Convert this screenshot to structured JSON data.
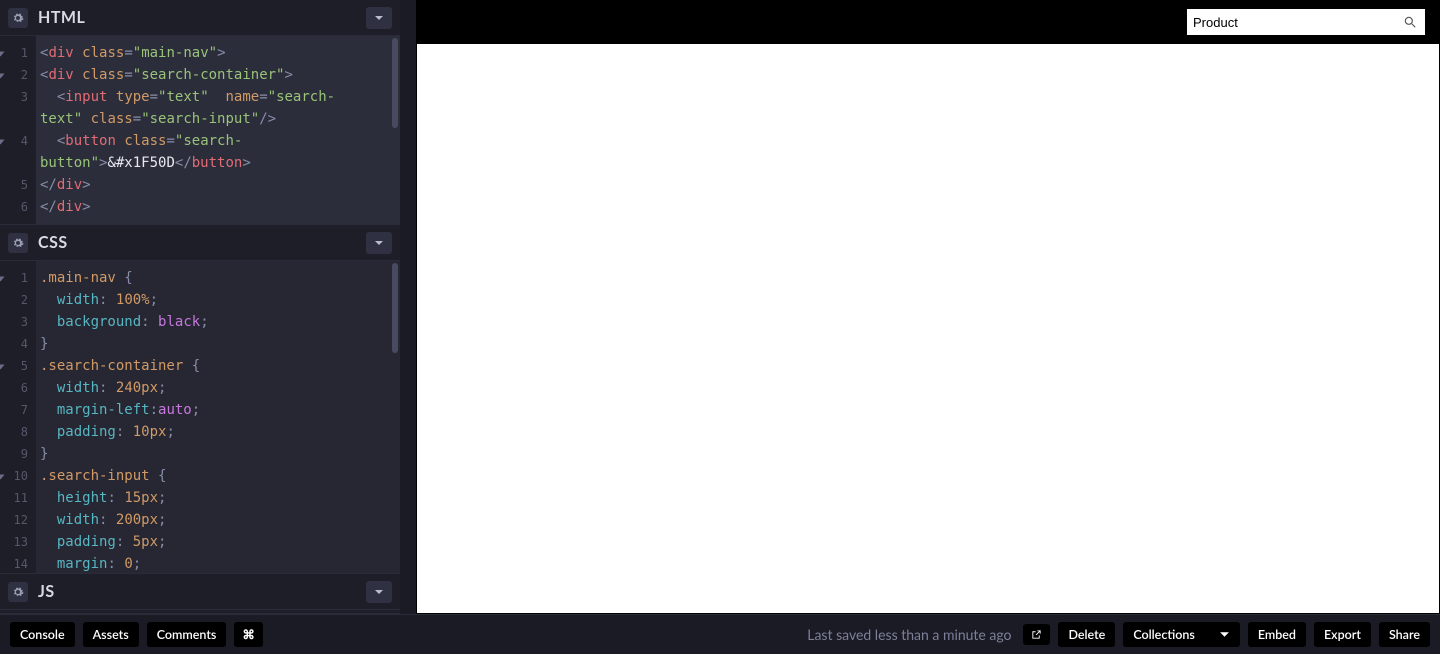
{
  "panels": {
    "html": {
      "title": "HTML"
    },
    "css": {
      "title": "CSS"
    },
    "js": {
      "title": "JS"
    }
  },
  "html_code": {
    "gutter": [
      "1",
      "2",
      "3",
      "",
      "4",
      "",
      "5",
      "6"
    ],
    "tokens": [
      [
        [
          "punc",
          "<"
        ],
        [
          "tag",
          "div"
        ],
        [
          "text",
          " "
        ],
        [
          "attr",
          "class"
        ],
        [
          "punc",
          "="
        ],
        [
          "str",
          "\"main-nav\""
        ],
        [
          "punc",
          ">"
        ]
      ],
      [
        [
          "punc",
          "<"
        ],
        [
          "tag",
          "div"
        ],
        [
          "text",
          " "
        ],
        [
          "attr",
          "class"
        ],
        [
          "punc",
          "="
        ],
        [
          "str",
          "\"search-container\""
        ],
        [
          "punc",
          ">"
        ]
      ],
      [
        [
          "text",
          "  "
        ],
        [
          "punc",
          "<"
        ],
        [
          "tag",
          "input"
        ],
        [
          "text",
          " "
        ],
        [
          "attr",
          "type"
        ],
        [
          "punc",
          "="
        ],
        [
          "str",
          "\"text\""
        ],
        [
          "text",
          "  "
        ],
        [
          "attr",
          "name"
        ],
        [
          "punc",
          "="
        ],
        [
          "str",
          "\"search-"
        ]
      ],
      [
        [
          "str",
          "text\""
        ],
        [
          "text",
          " "
        ],
        [
          "attr",
          "class"
        ],
        [
          "punc",
          "="
        ],
        [
          "str",
          "\"search-input\""
        ],
        [
          "punc",
          "/>"
        ]
      ],
      [
        [
          "text",
          "  "
        ],
        [
          "punc",
          "<"
        ],
        [
          "tag",
          "button"
        ],
        [
          "text",
          " "
        ],
        [
          "attr",
          "class"
        ],
        [
          "punc",
          "="
        ],
        [
          "str",
          "\"search-"
        ]
      ],
      [
        [
          "str",
          "button\""
        ],
        [
          "punc",
          ">"
        ],
        [
          "text",
          "&#x1F50D"
        ],
        [
          "punc",
          "</"
        ],
        [
          "tag",
          "button"
        ],
        [
          "punc",
          ">"
        ]
      ],
      [
        [
          "punc",
          "</"
        ],
        [
          "tag",
          "div"
        ],
        [
          "punc",
          ">"
        ]
      ],
      [
        [
          "punc",
          "</"
        ],
        [
          "tag",
          "div"
        ],
        [
          "punc",
          ">"
        ]
      ]
    ]
  },
  "css_code": {
    "gutter": [
      "1",
      "2",
      "3",
      "4",
      "5",
      "6",
      "7",
      "8",
      "9",
      "10",
      "11",
      "12",
      "13",
      "14"
    ],
    "tokens": [
      [
        [
          "selcls",
          ".main-nav"
        ],
        [
          "text",
          " "
        ],
        [
          "punc",
          "{"
        ]
      ],
      [
        [
          "text",
          "  "
        ],
        [
          "prop",
          "width"
        ],
        [
          "punc",
          ":"
        ],
        [
          "text",
          " "
        ],
        [
          "num",
          "100%"
        ],
        [
          "punc",
          ";"
        ]
      ],
      [
        [
          "text",
          "  "
        ],
        [
          "prop",
          "background"
        ],
        [
          "punc",
          ":"
        ],
        [
          "text",
          " "
        ],
        [
          "val",
          "black"
        ],
        [
          "punc",
          ";"
        ]
      ],
      [
        [
          "punc",
          "}"
        ]
      ],
      [
        [
          "selcls",
          ".search-container"
        ],
        [
          "text",
          " "
        ],
        [
          "punc",
          "{"
        ]
      ],
      [
        [
          "text",
          "  "
        ],
        [
          "prop",
          "width"
        ],
        [
          "punc",
          ":"
        ],
        [
          "text",
          " "
        ],
        [
          "num",
          "240px"
        ],
        [
          "punc",
          ";"
        ]
      ],
      [
        [
          "text",
          "  "
        ],
        [
          "prop",
          "margin-left"
        ],
        [
          "punc",
          ":"
        ],
        [
          "val",
          "auto"
        ],
        [
          "punc",
          ";"
        ]
      ],
      [
        [
          "text",
          "  "
        ],
        [
          "prop",
          "padding"
        ],
        [
          "punc",
          ":"
        ],
        [
          "text",
          " "
        ],
        [
          "num",
          "10px"
        ],
        [
          "punc",
          ";"
        ]
      ],
      [
        [
          "punc",
          "}"
        ]
      ],
      [
        [
          "selcls",
          ".search-input"
        ],
        [
          "text",
          " "
        ],
        [
          "punc",
          "{"
        ]
      ],
      [
        [
          "text",
          "  "
        ],
        [
          "prop",
          "height"
        ],
        [
          "punc",
          ":"
        ],
        [
          "text",
          " "
        ],
        [
          "num",
          "15px"
        ],
        [
          "punc",
          ";"
        ]
      ],
      [
        [
          "text",
          "  "
        ],
        [
          "prop",
          "width"
        ],
        [
          "punc",
          ":"
        ],
        [
          "text",
          " "
        ],
        [
          "num",
          "200px"
        ],
        [
          "punc",
          ";"
        ]
      ],
      [
        [
          "text",
          "  "
        ],
        [
          "prop",
          "padding"
        ],
        [
          "punc",
          ":"
        ],
        [
          "text",
          " "
        ],
        [
          "num",
          "5px"
        ],
        [
          "punc",
          ";"
        ]
      ],
      [
        [
          "text",
          "  "
        ],
        [
          "prop",
          "margin"
        ],
        [
          "punc",
          ":"
        ],
        [
          "text",
          " "
        ],
        [
          "num",
          "0"
        ],
        [
          "punc",
          ";"
        ]
      ]
    ]
  },
  "preview": {
    "search_value": "Product"
  },
  "footer": {
    "console": "Console",
    "assets": "Assets",
    "comments": "Comments",
    "shortcut_icon": "⌘",
    "status": "Last saved less than a minute ago",
    "delete": "Delete",
    "collections": "Collections",
    "embed": "Embed",
    "export": "Export",
    "share": "Share"
  }
}
